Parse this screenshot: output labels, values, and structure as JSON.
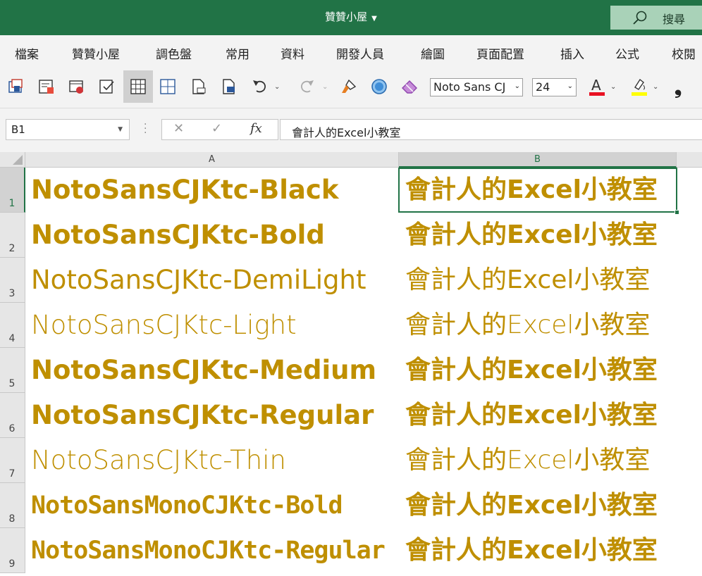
{
  "titlebar": {
    "title": "贊贊小屋",
    "search_label": "搜尋"
  },
  "tabs": [
    "檔案",
    "贊贊小屋",
    "調色盤",
    "常用",
    "資料",
    "開發人員",
    "繪圖",
    "頁面配置",
    "插入",
    "公式",
    "校閱"
  ],
  "toolbar": {
    "font_name": "Noto Sans CJ",
    "font_size": "24",
    "font_color": "#e81123",
    "highlight_color": "#ffff00",
    "comma_label": "❟"
  },
  "formula_bar": {
    "name_box": "B1",
    "cancel": "✕",
    "enter": "✓",
    "fx": "fx",
    "formula": "會計人的Excel小教室"
  },
  "columns": [
    "A",
    "B"
  ],
  "rows": [
    {
      "num": "1",
      "a": "NotoSansCJKtc-Black",
      "b": "會計人的Excel小教室",
      "weight": "900",
      "mono": false
    },
    {
      "num": "2",
      "a": "NotoSansCJKtc-Bold",
      "b": "會計人的Excel小教室",
      "weight": "700",
      "mono": false
    },
    {
      "num": "3",
      "a": "NotoSansCJKtc-DemiLight",
      "b": "會計人的Excel小教室",
      "weight": "400",
      "mono": false
    },
    {
      "num": "4",
      "a": "NotoSansCJKtc-Light",
      "b": "會計人的Excel小教室",
      "weight": "300",
      "mono": false
    },
    {
      "num": "5",
      "a": "NotoSansCJKtc-Medium",
      "b": "會計人的Excel小教室",
      "weight": "700",
      "mono": false
    },
    {
      "num": "6",
      "a": "NotoSansCJKtc-Regular",
      "b": "會計人的Excel小教室",
      "weight": "600",
      "mono": false
    },
    {
      "num": "7",
      "a": "NotoSansCJKtc-Thin",
      "b": "會計人的Excel小教室",
      "weight": "200",
      "mono": false
    },
    {
      "num": "8",
      "a": "NotoSansMonoCJKtc-Bold",
      "b": "會計人的Excel小教室",
      "weight": "700",
      "mono": true
    },
    {
      "num": "9",
      "a": "NotoSansMonoCJKtc-Regular",
      "b": "會計人的Excel小教室",
      "weight": "600",
      "mono": true
    }
  ],
  "colors": {
    "accent": "#217346",
    "cell_text": "#bf8f00"
  }
}
